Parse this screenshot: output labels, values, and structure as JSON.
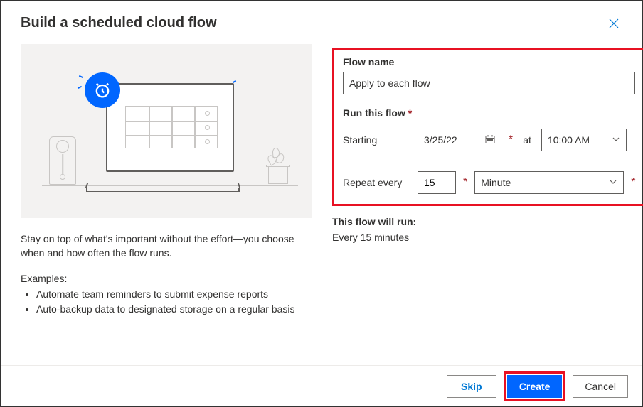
{
  "dialog": {
    "title": "Build a scheduled cloud flow",
    "close_label": "Close"
  },
  "left": {
    "description": "Stay on top of what's important without the effort—you choose when and how often the flow runs.",
    "examples_label": "Examples:",
    "examples": [
      "Automate team reminders to submit expense reports",
      "Auto-backup data to designated storage on a regular basis"
    ]
  },
  "form": {
    "flow_name_label": "Flow name",
    "flow_name_value": "Apply to each flow",
    "run_label": "Run this flow",
    "starting_label": "Starting",
    "starting_date": "3/25/22",
    "at_label": "at",
    "starting_time": "10:00 AM",
    "repeat_label": "Repeat every",
    "repeat_value": "15",
    "repeat_unit": "Minute"
  },
  "summary": {
    "label": "This flow will run:",
    "text": "Every 15 minutes"
  },
  "footer": {
    "skip": "Skip",
    "create": "Create",
    "cancel": "Cancel"
  }
}
